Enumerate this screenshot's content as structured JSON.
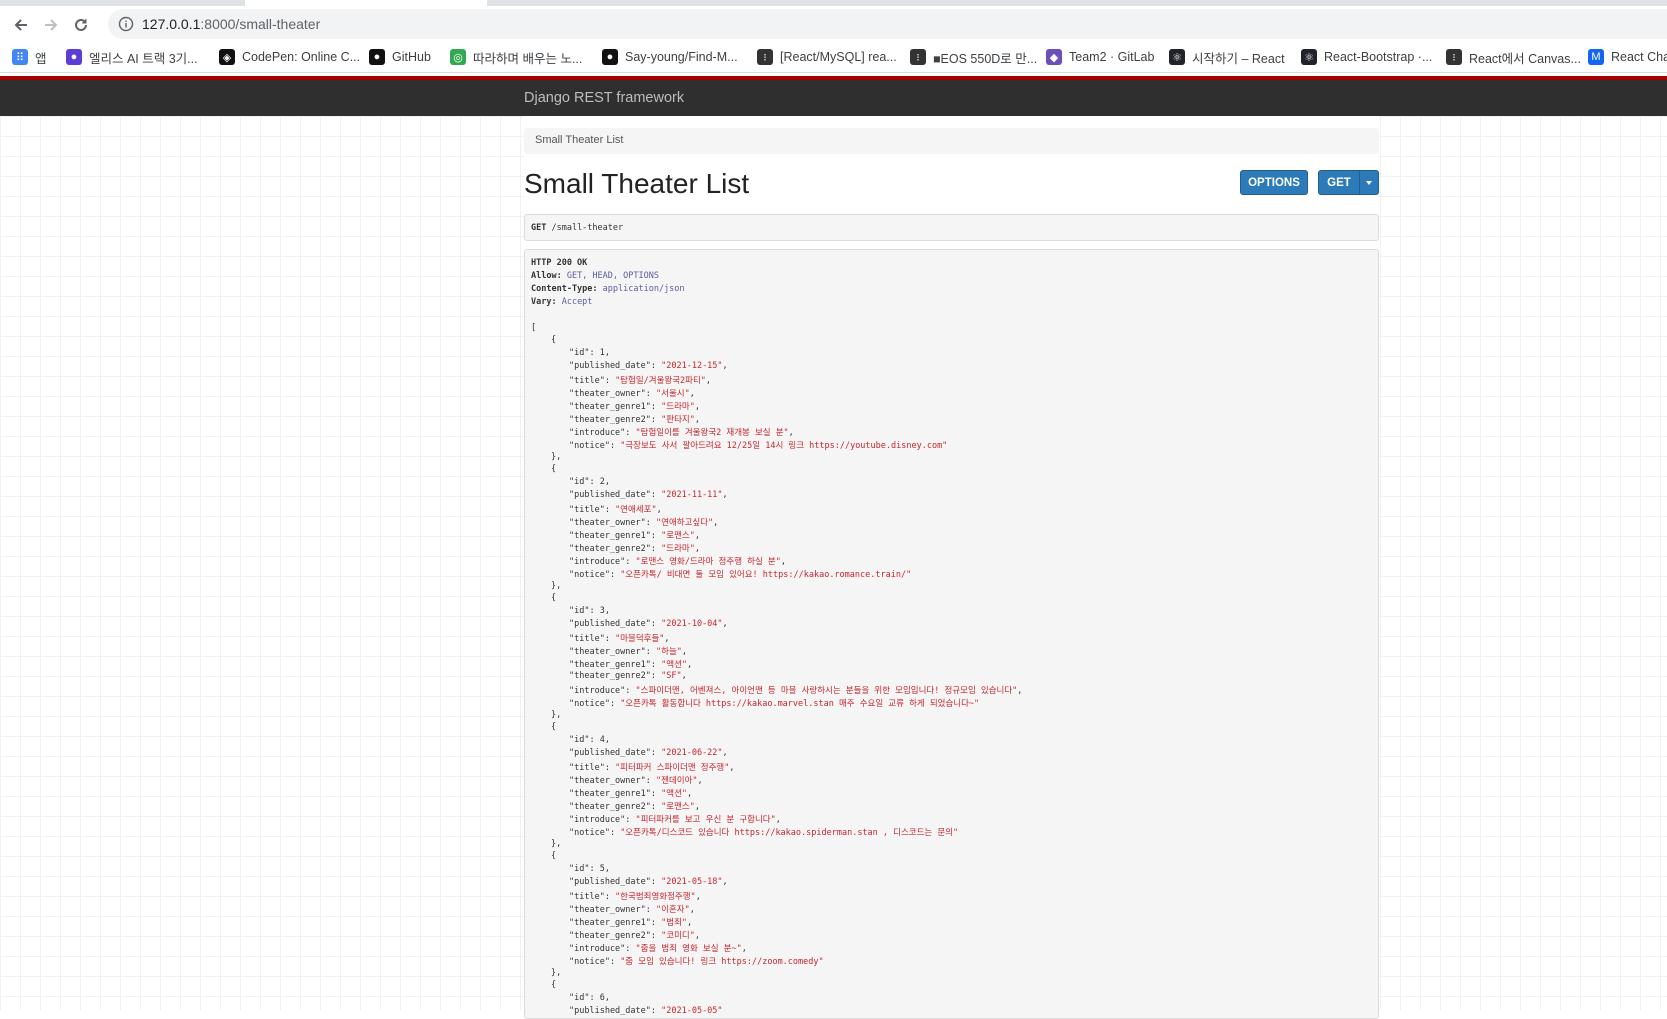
{
  "browser": {
    "url_host": "127.0.0.1",
    "url_path": ":8000/small-theater",
    "bookmarks": [
      {
        "label": "앱",
        "icon": "apps-grid-icon",
        "color": "#4285f4"
      },
      {
        "label": "엘리스 AI 트랙 3기...",
        "icon": "elice-icon",
        "color": "#5a3fd6"
      },
      {
        "label": "CodePen: Online C...",
        "icon": "codepen-icon",
        "color": "#111111"
      },
      {
        "label": "GitHub",
        "icon": "github-icon",
        "color": "#111111"
      },
      {
        "label": "따라하며 배우는 노...",
        "icon": "inflearn-icon",
        "color": "#34a853"
      },
      {
        "label": "Say-young/Find-M...",
        "icon": "github-icon",
        "color": "#111111"
      },
      {
        "label": "[React/MySQL] rea...",
        "icon": "tistory-icon",
        "color": "#333333"
      },
      {
        "label": "■EOS 550D로 만...",
        "icon": "tistory-icon",
        "color": "#333333"
      },
      {
        "label": "Team2 · GitLab",
        "icon": "gitlab-icon",
        "color": "#6b4fbb"
      },
      {
        "label": "시작하기 – React",
        "icon": "react-icon",
        "color": "#20232a"
      },
      {
        "label": "React-Bootstrap ·...",
        "icon": "react-icon",
        "color": "#20232a"
      },
      {
        "label": "React에서 Canvas...",
        "icon": "tistory-icon",
        "color": "#333333"
      },
      {
        "label": "React Cha",
        "icon": "mdb-icon",
        "color": "#1266f1"
      }
    ]
  },
  "app": {
    "brand": "Django REST framework",
    "breadcrumb": "Small Theater List",
    "title": "Small Theater List",
    "options_label": "OPTIONS",
    "get_label": "GET"
  },
  "request": {
    "method": "GET",
    "path": " /small-theater"
  },
  "response": {
    "headers": [
      {
        "key": "HTTP 200 OK",
        "value": ""
      },
      {
        "key": "Allow:",
        "value": " GET, HEAD, OPTIONS"
      },
      {
        "key": "Content-Type:",
        "value": " application/json"
      },
      {
        "key": "Vary:",
        "value": " Accept"
      }
    ],
    "items": [
      {
        "id": "1",
        "published_date": "\"2021-12-15\"",
        "title": "\"탐험일/겨울왕국2파티\"",
        "theater_owner": "\"서울시\"",
        "theater_genre1": "\"드라마\"",
        "theater_genre2": "\"판타지\"",
        "introduce": "\"탐험일이를 겨울왕국2 재개봉 보실 분\"",
        "notice": "\"극장보도 사서 팔아드려요 12/25일 14시 링크 https://youtube.disney.com\""
      },
      {
        "id": "2",
        "published_date": "\"2021-11-11\"",
        "title": "\"연애세포\"",
        "theater_owner": "\"연애하고싶다\"",
        "theater_genre1": "\"로맨스\"",
        "theater_genre2": "\"드라마\"",
        "introduce": "\"로맨스 영화/드라마 정주행 하실 분\"",
        "notice": "\"오픈카톡/ 비대면 둘 모임 있어요! https://kakao.romance.train/\""
      },
      {
        "id": "3",
        "published_date": "\"2021-10-04\"",
        "title": "\"마블덕후들\"",
        "theater_owner": "\"하늘\"",
        "theater_genre1": "\"액션\"",
        "theater_genre2": "\"SF\"",
        "introduce": "\"스파이더맨, 어벤져스, 아이언맨 등 마블 사랑하시는 분들을 위한 모임입니다! 정규모임 있습니다\"",
        "notice": "\"오픈카톡 활동합니다 https://kakao.marvel.stan 매주 수요일 교류 하게 되었습니다~\""
      },
      {
        "id": "4",
        "published_date": "\"2021-06-22\"",
        "title": "\"피터파커 스파이더맨 정주행\"",
        "theater_owner": "\"젠데이아\"",
        "theater_genre1": "\"액션\"",
        "theater_genre2": "\"로맨스\"",
        "introduce": "\"피터파커를 보고 우신 분 구합니다\"",
        "notice": "\"오픈카톡/디스코드 있습니다 https://kakao.spiderman.stan , 디스코드는 문의\""
      },
      {
        "id": "5",
        "published_date": "\"2021-05-18\"",
        "title": "\"한국범죄영화정주행\"",
        "theater_owner": "\"이혼자\"",
        "theater_genre1": "\"범죄\"",
        "theater_genre2": "\"코미디\"",
        "introduce": "\"줌을 범죄 영화 보실 분~\"",
        "notice": "\"줌 모임 있습니다! 링크 https://zoom.comedy\""
      },
      {
        "id": "6",
        "published_date": "\"2021-05-05\""
      }
    ]
  }
}
